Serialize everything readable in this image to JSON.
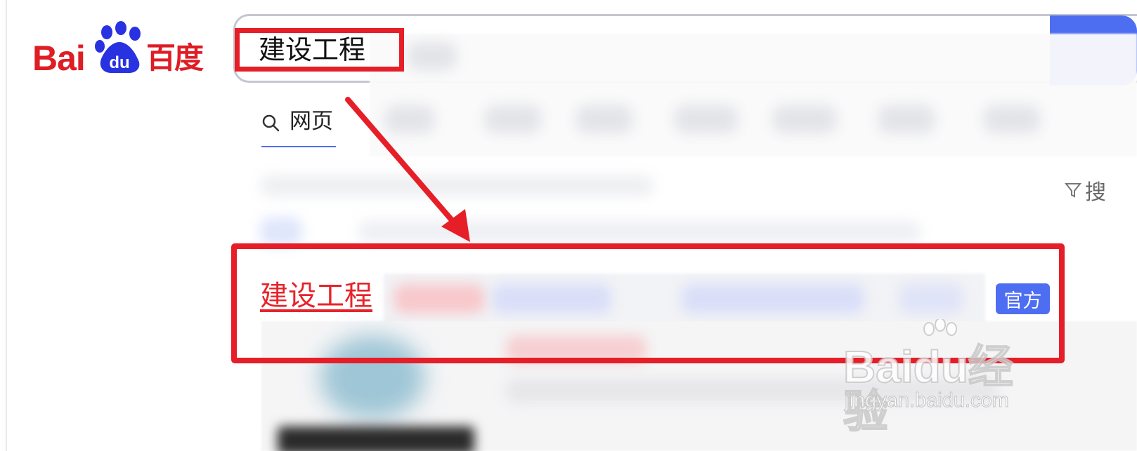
{
  "logo": {
    "latin": "Bai",
    "paw_text": "du",
    "chinese": "百度"
  },
  "search": {
    "query": "建设工程"
  },
  "tabs": [
    {
      "label": "网页",
      "icon": "search-icon"
    }
  ],
  "tools": {
    "label": "搜",
    "icon": "filter-icon"
  },
  "result": {
    "title": "建设工程",
    "badge": "官方"
  },
  "watermark": {
    "brand": "Baidu经验",
    "url": "jingyan.baidu.com"
  },
  "colors": {
    "brand_red": "#de1d24",
    "accent_blue": "#4e6ef2",
    "annotation_red": "#e61e28"
  }
}
